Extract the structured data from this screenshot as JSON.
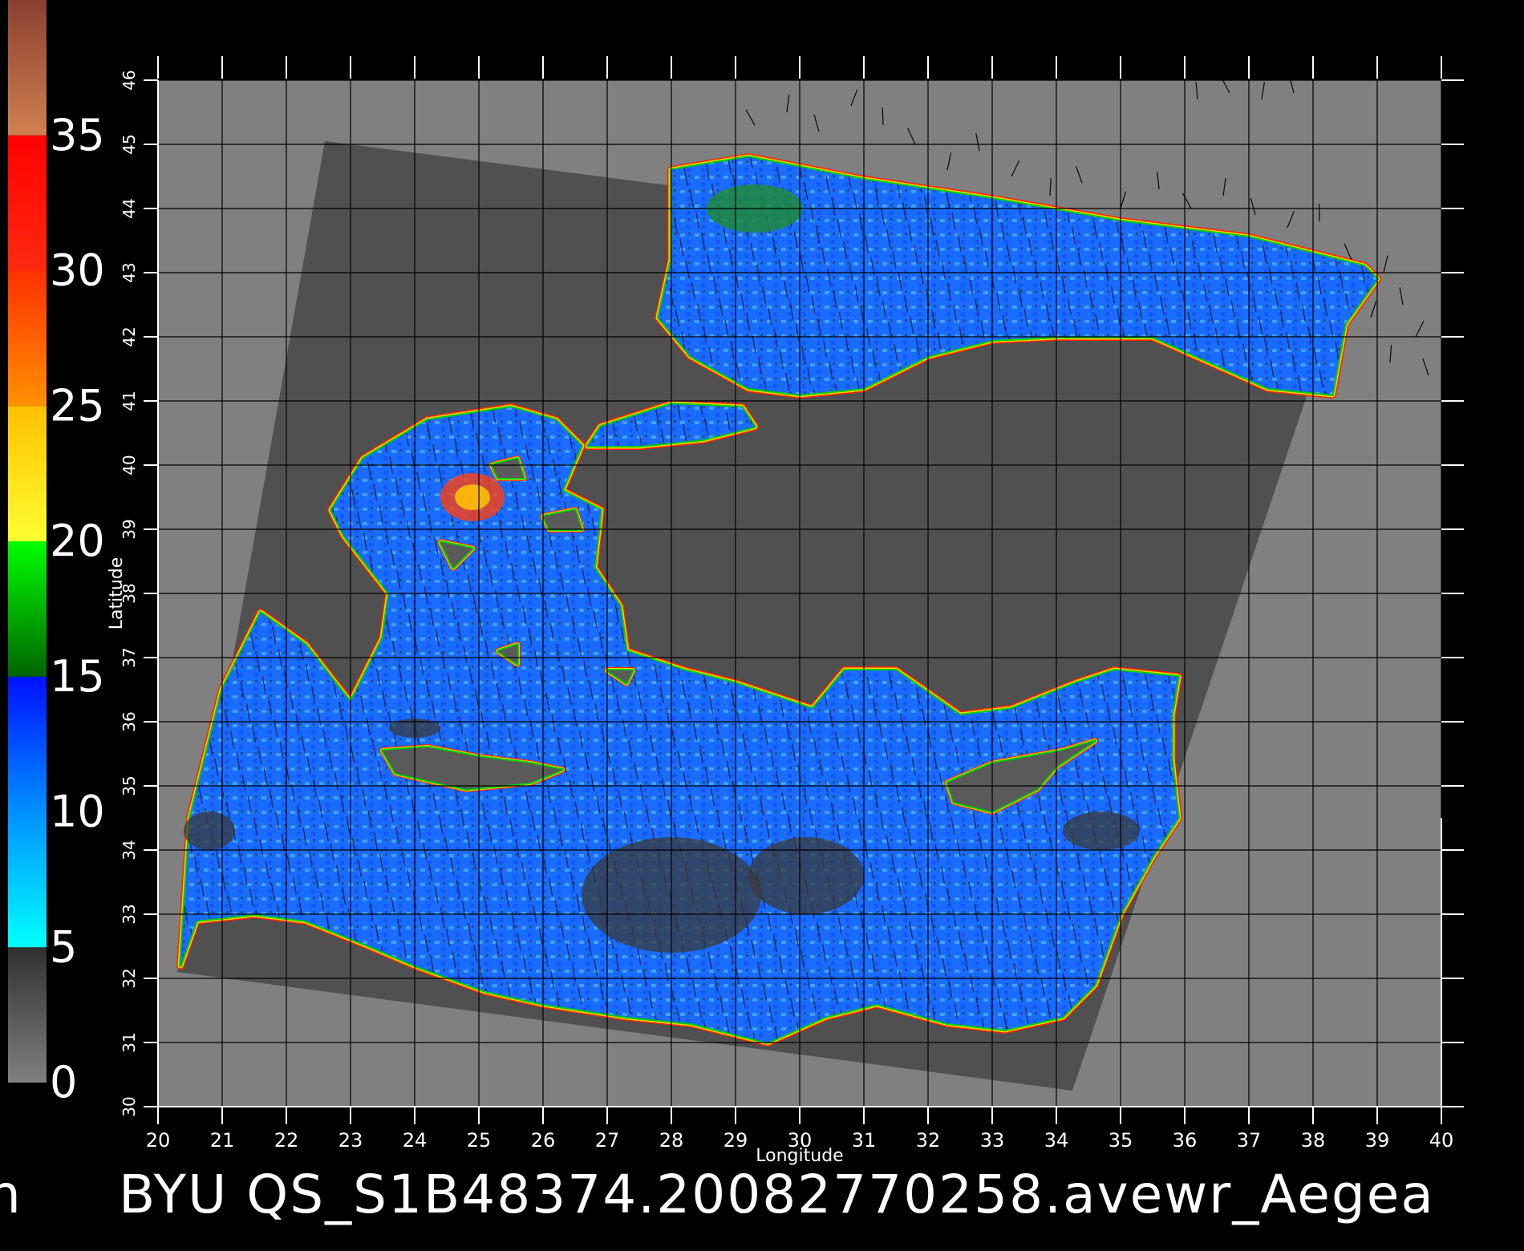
{
  "title": "BYU  QS_S1B48374.20082770258.avewr_Aegea",
  "title_left_fragment": "n",
  "x_axis_label": "Longitude",
  "y_axis_label": "Latitude",
  "longitude_ticks": [
    "20",
    "21",
    "22",
    "23",
    "24",
    "25",
    "26",
    "27",
    "28",
    "29",
    "30",
    "31",
    "32",
    "33",
    "34",
    "35",
    "36",
    "37",
    "38",
    "39",
    "40"
  ],
  "latitude_ticks": [
    "30",
    "31",
    "32",
    "33",
    "34",
    "35",
    "36",
    "37",
    "38",
    "39",
    "40",
    "41",
    "42",
    "43",
    "44",
    "45",
    "46"
  ],
  "colorbar": {
    "labels": [
      "0",
      "5",
      "10",
      "15",
      "20",
      "25",
      "30",
      "35"
    ],
    "range": [
      0,
      40
    ],
    "stops": [
      {
        "from": 0,
        "to": 5,
        "colors": [
          "#808080",
          "#303030"
        ]
      },
      {
        "from": 5,
        "to": 10,
        "colors": [
          "#00ffff",
          "#0090ff"
        ]
      },
      {
        "from": 10,
        "to": 15,
        "colors": [
          "#0090ff",
          "#0010ff"
        ]
      },
      {
        "from": 15,
        "to": 20,
        "colors": [
          "#006400",
          "#00ff00"
        ]
      },
      {
        "from": 20,
        "to": 25,
        "colors": [
          "#ffff30",
          "#ffc000"
        ]
      },
      {
        "from": 25,
        "to": 30,
        "colors": [
          "#ff9000",
          "#ff3000"
        ]
      },
      {
        "from": 30,
        "to": 35,
        "colors": [
          "#ff2a10",
          "#ff0000"
        ]
      },
      {
        "from": 35,
        "to": 40,
        "colors": [
          "#d08050",
          "#8a4030"
        ]
      }
    ]
  },
  "map": {
    "lon_range": [
      20,
      40
    ],
    "lat_range": [
      30,
      46
    ],
    "background_color": "#808080",
    "swath_color": "#505050",
    "sea_color": "#1a6cff",
    "sea_highlight_color": "#3fb0ff",
    "land_color": "#5a5a5a",
    "coast_colors": [
      "#ff2000",
      "#ffd000",
      "#00d000"
    ],
    "wind_vector_color": "#101010"
  }
}
